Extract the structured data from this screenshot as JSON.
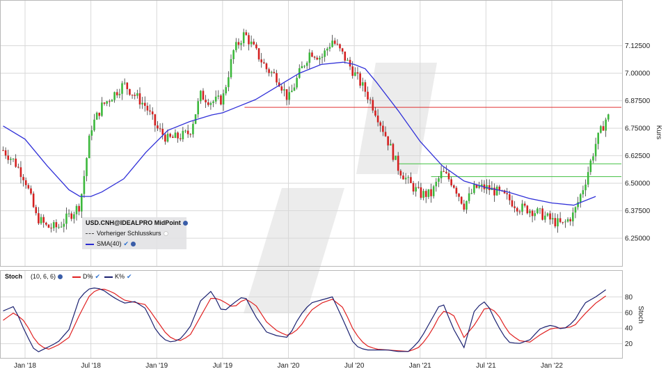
{
  "chart_data": [
    {
      "type": "candlestick",
      "instrument": "USD.CNH@IDEALPRO MidPoint",
      "ylabel": "Kurs",
      "ylim": [
        6.13,
        7.32
      ],
      "y_ticks": [
        "7.12500",
        "7.00000",
        "6.87500",
        "6.75000",
        "6.62500",
        "6.50000",
        "6.37500",
        "6.25000"
      ],
      "x_ticks": [
        "Jan '18",
        "Jul '18",
        "Jan '19",
        "Jul '19",
        "Jan '20",
        "Jul '20",
        "Jan '21",
        "Jul '21",
        "Jan '22"
      ],
      "legend": {
        "title": "USD.CNH@IDEALPRO MidPoint",
        "prev_close": "Vorheriger Schlusskurs",
        "sma": "SMA(40)"
      },
      "horizontal_lines": [
        {
          "value": 6.845,
          "color": "#e03030",
          "from": "2019-09"
        },
        {
          "value": 6.588,
          "color": "#40c040",
          "from": "2020-11"
        },
        {
          "value": 6.53,
          "color": "#40c040",
          "from": "2021-02"
        }
      ],
      "close_series": [
        [
          "2017-11",
          6.65
        ],
        [
          "2017-12",
          6.6
        ],
        [
          "2018-01",
          6.52
        ],
        [
          "2018-02",
          6.35
        ],
        [
          "2018-03",
          6.3
        ],
        [
          "2018-04",
          6.3
        ],
        [
          "2018-05",
          6.35
        ],
        [
          "2018-06",
          6.4
        ],
        [
          "2018-07",
          6.75
        ],
        [
          "2018-08",
          6.85
        ],
        [
          "2018-09",
          6.9
        ],
        [
          "2018-10",
          6.95
        ],
        [
          "2018-11",
          6.9
        ],
        [
          "2018-12",
          6.85
        ],
        [
          "2019-01",
          6.75
        ],
        [
          "2019-02",
          6.7
        ],
        [
          "2019-03",
          6.71
        ],
        [
          "2019-04",
          6.73
        ],
        [
          "2019-05",
          6.9
        ],
        [
          "2019-06",
          6.87
        ],
        [
          "2019-07",
          6.88
        ],
        [
          "2019-08",
          7.1
        ],
        [
          "2019-09",
          7.18
        ],
        [
          "2019-10",
          7.1
        ],
        [
          "2019-11",
          7.02
        ],
        [
          "2019-12",
          6.98
        ],
        [
          "2020-01",
          6.88
        ],
        [
          "2020-02",
          7.0
        ],
        [
          "2020-03",
          7.1
        ],
        [
          "2020-04",
          7.07
        ],
        [
          "2020-05",
          7.15
        ],
        [
          "2020-06",
          7.08
        ],
        [
          "2020-07",
          7.0
        ],
        [
          "2020-08",
          6.92
        ],
        [
          "2020-09",
          6.82
        ],
        [
          "2020-10",
          6.7
        ],
        [
          "2020-11",
          6.57
        ],
        [
          "2020-12",
          6.5
        ],
        [
          "2021-01",
          6.45
        ],
        [
          "2021-02",
          6.45
        ],
        [
          "2021-03",
          6.55
        ],
        [
          "2021-04",
          6.5
        ],
        [
          "2021-05",
          6.4
        ],
        [
          "2021-06",
          6.48
        ],
        [
          "2021-07",
          6.48
        ],
        [
          "2021-08",
          6.46
        ],
        [
          "2021-09",
          6.43
        ],
        [
          "2021-10",
          6.39
        ],
        [
          "2021-11",
          6.38
        ],
        [
          "2021-12",
          6.36
        ],
        [
          "2022-01",
          6.33
        ],
        [
          "2022-02",
          6.31
        ],
        [
          "2022-03",
          6.36
        ],
        [
          "2022-04",
          6.5
        ],
        [
          "2022-05",
          6.68
        ],
        [
          "2022-06",
          6.8
        ]
      ],
      "sma40": [
        [
          "2017-11",
          6.76
        ],
        [
          "2018-01",
          6.7
        ],
        [
          "2018-03",
          6.58
        ],
        [
          "2018-05",
          6.47
        ],
        [
          "2018-06",
          6.44
        ],
        [
          "2018-07",
          6.44
        ],
        [
          "2018-08",
          6.46
        ],
        [
          "2018-10",
          6.52
        ],
        [
          "2018-12",
          6.64
        ],
        [
          "2019-02",
          6.74
        ],
        [
          "2019-04",
          6.78
        ],
        [
          "2019-06",
          6.81
        ],
        [
          "2019-07",
          6.82
        ],
        [
          "2019-08",
          6.84
        ],
        [
          "2019-10",
          6.88
        ],
        [
          "2019-12",
          6.94
        ],
        [
          "2020-02",
          7.0
        ],
        [
          "2020-04",
          7.04
        ],
        [
          "2020-06",
          7.05
        ],
        [
          "2020-07",
          7.04
        ],
        [
          "2020-08",
          7.02
        ],
        [
          "2020-09",
          6.96
        ],
        [
          "2020-11",
          6.83
        ],
        [
          "2021-01",
          6.69
        ],
        [
          "2021-03",
          6.58
        ],
        [
          "2021-05",
          6.51
        ],
        [
          "2021-07",
          6.48
        ],
        [
          "2021-09",
          6.46
        ],
        [
          "2021-11",
          6.43
        ],
        [
          "2022-01",
          6.41
        ],
        [
          "2022-03",
          6.4
        ],
        [
          "2022-05",
          6.44
        ]
      ]
    },
    {
      "type": "line",
      "name": "Stoch",
      "params": "(10, 6, 6)",
      "ylabel": "Stoch",
      "ylim": [
        0,
        100
      ],
      "y_ticks": [
        "80",
        "60",
        "40",
        "20"
      ],
      "series": [
        {
          "name": "K%",
          "color": "#1a2070",
          "points": [
            [
              "2017-11",
              62
            ],
            [
              "2017-12",
              68
            ],
            [
              "2018-01",
              35
            ],
            [
              "2018-02",
              8
            ],
            [
              "2018-03",
              15
            ],
            [
              "2018-04",
              22
            ],
            [
              "2018-05",
              38
            ],
            [
              "2018-06",
              80
            ],
            [
              "2018-07",
              92
            ],
            [
              "2018-08",
              90
            ],
            [
              "2018-09",
              80
            ],
            [
              "2018-10",
              72
            ],
            [
              "2018-11",
              74
            ],
            [
              "2018-12",
              65
            ],
            [
              "2019-01",
              35
            ],
            [
              "2019-02",
              22
            ],
            [
              "2019-03",
              24
            ],
            [
              "2019-04",
              40
            ],
            [
              "2019-05",
              75
            ],
            [
              "2019-06",
              88
            ],
            [
              "2019-07",
              60
            ],
            [
              "2019-08",
              72
            ],
            [
              "2019-09",
              82
            ],
            [
              "2019-10",
              55
            ],
            [
              "2019-11",
              35
            ],
            [
              "2019-12",
              30
            ],
            [
              "2020-01",
              28
            ],
            [
              "2020-02",
              55
            ],
            [
              "2020-03",
              72
            ],
            [
              "2020-04",
              76
            ],
            [
              "2020-05",
              80
            ],
            [
              "2020-06",
              50
            ],
            [
              "2020-07",
              18
            ],
            [
              "2020-08",
              12
            ],
            [
              "2020-09",
              12
            ],
            [
              "2020-10",
              12
            ],
            [
              "2020-11",
              10
            ],
            [
              "2020-12",
              10
            ],
            [
              "2021-01",
              25
            ],
            [
              "2021-02",
              50
            ],
            [
              "2021-03",
              75
            ],
            [
              "2021-04",
              40
            ],
            [
              "2021-05",
              15
            ],
            [
              "2021-06",
              65
            ],
            [
              "2021-07",
              75
            ],
            [
              "2021-08",
              45
            ],
            [
              "2021-09",
              22
            ],
            [
              "2021-10",
              20
            ],
            [
              "2021-11",
              25
            ],
            [
              "2021-12",
              40
            ],
            [
              "2022-01",
              44
            ],
            [
              "2022-02",
              38
            ],
            [
              "2022-03",
              48
            ],
            [
              "2022-04",
              72
            ],
            [
              "2022-05",
              80
            ],
            [
              "2022-06",
              90
            ]
          ]
        },
        {
          "name": "D%",
          "color": "#e02020",
          "points": [
            [
              "2017-11",
              50
            ],
            [
              "2017-12",
              60
            ],
            [
              "2018-01",
              48
            ],
            [
              "2018-02",
              22
            ],
            [
              "2018-03",
              12
            ],
            [
              "2018-04",
              18
            ],
            [
              "2018-05",
              28
            ],
            [
              "2018-06",
              58
            ],
            [
              "2018-07",
              85
            ],
            [
              "2018-08",
              91
            ],
            [
              "2018-09",
              86
            ],
            [
              "2018-10",
              76
            ],
            [
              "2018-11",
              73
            ],
            [
              "2018-12",
              70
            ],
            [
              "2019-01",
              50
            ],
            [
              "2019-02",
              30
            ],
            [
              "2019-03",
              23
            ],
            [
              "2019-04",
              30
            ],
            [
              "2019-05",
              55
            ],
            [
              "2019-06",
              80
            ],
            [
              "2019-07",
              75
            ],
            [
              "2019-08",
              66
            ],
            [
              "2019-09",
              78
            ],
            [
              "2019-10",
              70
            ],
            [
              "2019-11",
              48
            ],
            [
              "2019-12",
              36
            ],
            [
              "2020-01",
              30
            ],
            [
              "2020-02",
              40
            ],
            [
              "2020-03",
              62
            ],
            [
              "2020-04",
              72
            ],
            [
              "2020-05",
              77
            ],
            [
              "2020-06",
              66
            ],
            [
              "2020-07",
              35
            ],
            [
              "2020-08",
              18
            ],
            [
              "2020-09",
              13
            ],
            [
              "2020-10",
              12
            ],
            [
              "2020-11",
              11
            ],
            [
              "2020-12",
              10
            ],
            [
              "2021-01",
              16
            ],
            [
              "2021-02",
              35
            ],
            [
              "2021-03",
              62
            ],
            [
              "2021-04",
              58
            ],
            [
              "2021-05",
              28
            ],
            [
              "2021-06",
              45
            ],
            [
              "2021-07",
              68
            ],
            [
              "2021-08",
              60
            ],
            [
              "2021-09",
              35
            ],
            [
              "2021-10",
              24
            ],
            [
              "2021-11",
              22
            ],
            [
              "2021-12",
              32
            ],
            [
              "2022-01",
              40
            ],
            [
              "2022-02",
              40
            ],
            [
              "2022-03",
              42
            ],
            [
              "2022-04",
              58
            ],
            [
              "2022-05",
              72
            ],
            [
              "2022-06",
              82
            ]
          ]
        }
      ]
    }
  ],
  "colors": {
    "up": "#3cb83c",
    "down": "#d42020",
    "sma": "#3030d8",
    "grid": "#d8d8d8",
    "watermark": "#dcdcdc"
  }
}
